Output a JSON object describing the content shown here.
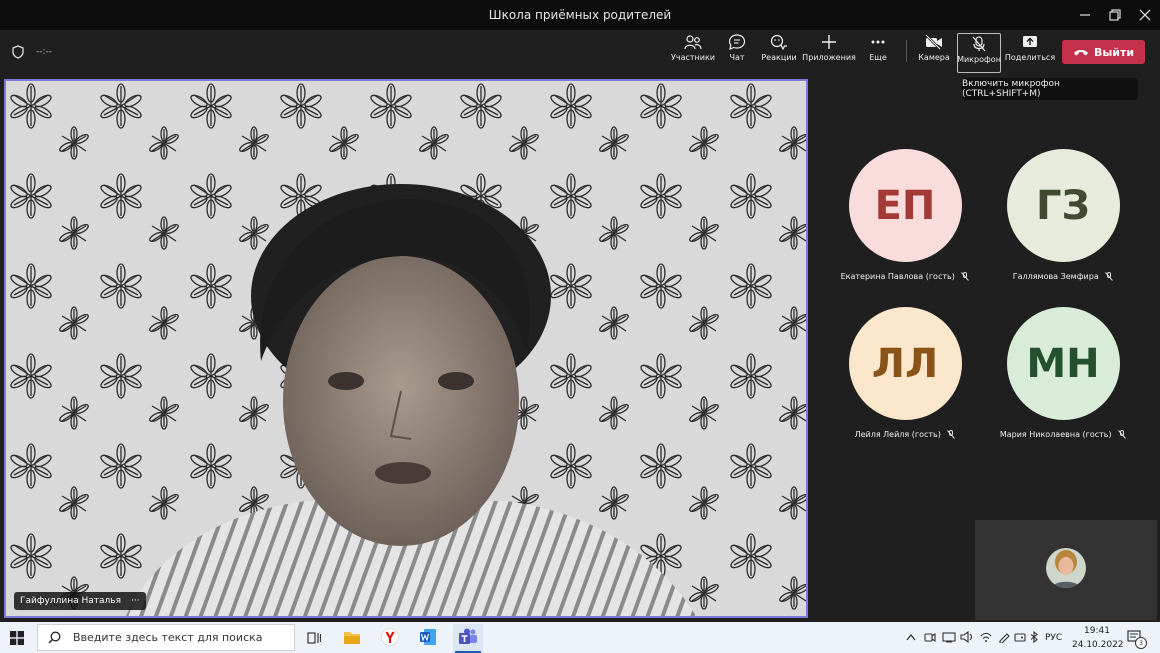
{
  "window": {
    "title": "Школа приёмных родителей",
    "meeting_timer": "--:--"
  },
  "toolbar": {
    "participants": "Участники",
    "chat": "Чат",
    "reactions": "Реакции",
    "apps": "Приложения",
    "more": "Еще",
    "camera": "Камера",
    "microphone": "Микрофон",
    "share": "Поделиться",
    "leave": "Выйти"
  },
  "tooltip": "Включить микрофон (CTRL+SHIFT+M)",
  "main_video": {
    "name": "Гайфуллина Наталья",
    "more": "···"
  },
  "participants": [
    {
      "initials": "ЕП",
      "name": "Екатерина Павлова (гость)",
      "bg": "#f9dcdc",
      "fg": "#a33a36"
    },
    {
      "initials": "ГЗ",
      "name": "Галлямова Земфира",
      "bg": "#e6ebdc",
      "fg": "#3f4a30"
    },
    {
      "initials": "ЛЛ",
      "name": "Лейля Лейля (гость)",
      "bg": "#fbe8cc",
      "fg": "#8a5418"
    },
    {
      "initials": "МН",
      "name": "Мария Николаевна (гость)",
      "bg": "#d8ecd8",
      "fg": "#24502e"
    }
  ],
  "taskbar": {
    "search_placeholder": "Введите здесь текст для поиска",
    "language": "РУС",
    "time": "19:41",
    "date": "24.10.2022",
    "notifications": "3"
  },
  "colors": {
    "leave": "#c4314b",
    "video_border": "#7a7ad8",
    "taskbar": "#eef3fa"
  }
}
